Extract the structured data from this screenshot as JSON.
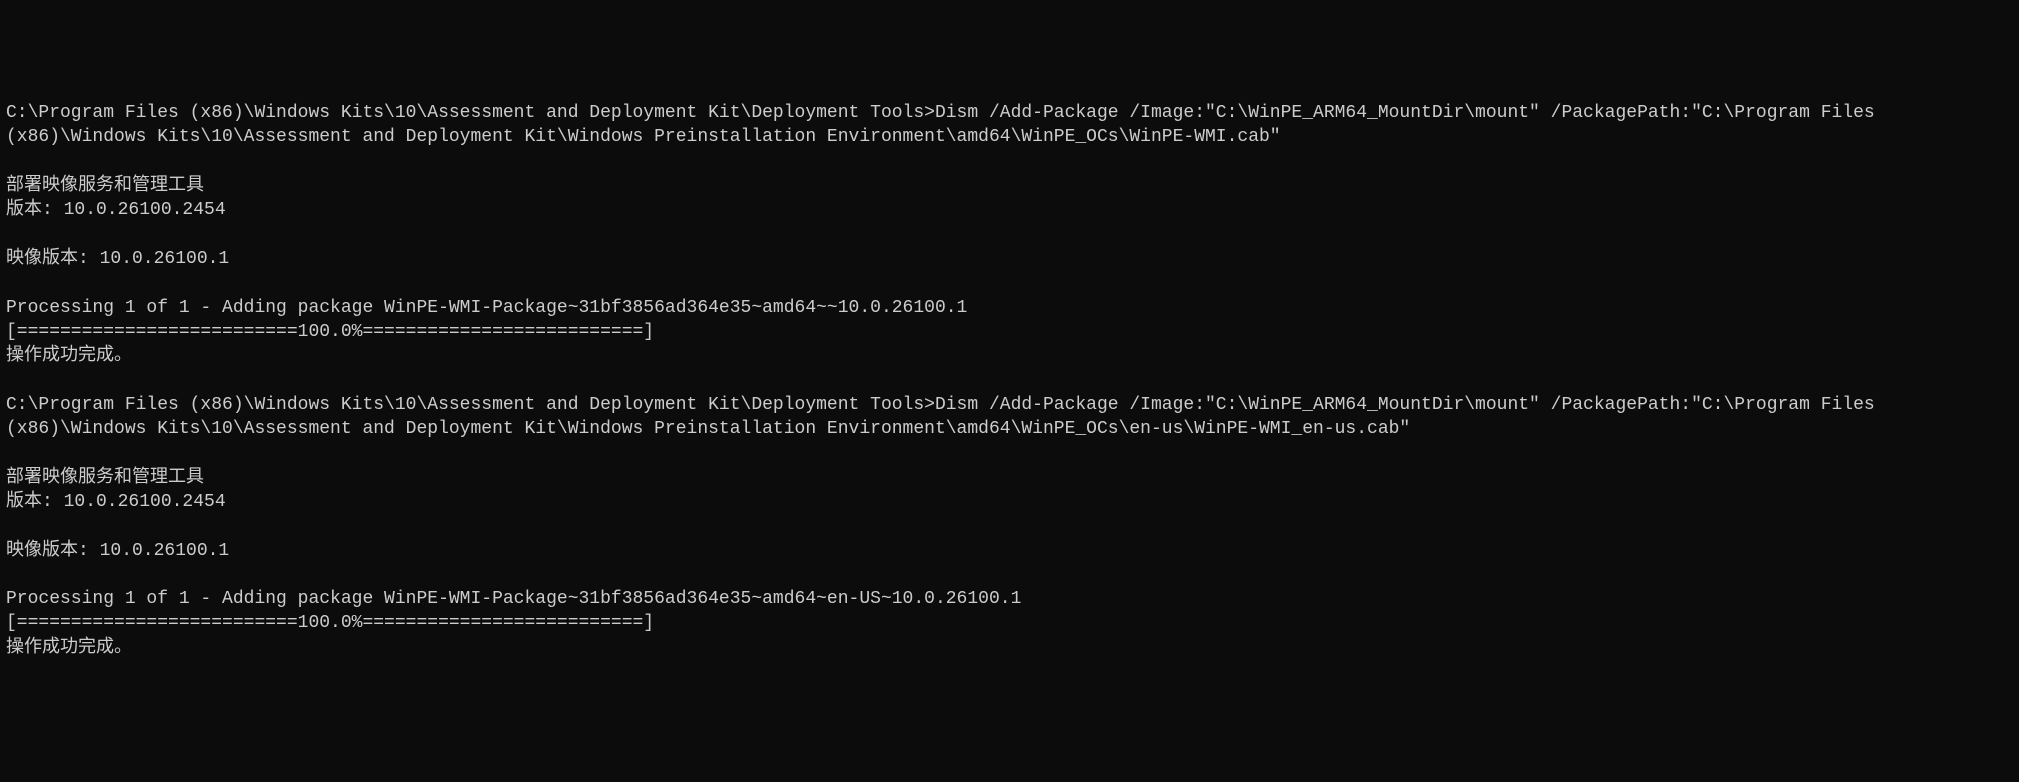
{
  "block1": {
    "prompt": "C:\\Program Files (x86)\\Windows Kits\\10\\Assessment and Deployment Kit\\Deployment Tools>",
    "command": "Dism /Add-Package /Image:\"C:\\WinPE_ARM64_MountDir\\mount\" /PackagePath:\"C:\\Program Files (x86)\\Windows Kits\\10\\Assessment and Deployment Kit\\Windows Preinstallation Environment\\amd64\\WinPE_OCs\\WinPE-WMI.cab\"",
    "tool_name": "部署映像服务和管理工具",
    "version_label": "版本: 10.0.26100.2454",
    "image_version": "映像版本: 10.0.26100.1",
    "processing": "Processing 1 of 1 - Adding package WinPE-WMI-Package~31bf3856ad364e35~amd64~~10.0.26100.1",
    "progress": "[==========================100.0%==========================]",
    "success": "操作成功完成。"
  },
  "block2": {
    "prompt": "C:\\Program Files (x86)\\Windows Kits\\10\\Assessment and Deployment Kit\\Deployment Tools>",
    "command": "Dism /Add-Package /Image:\"C:\\WinPE_ARM64_MountDir\\mount\" /PackagePath:\"C:\\Program Files (x86)\\Windows Kits\\10\\Assessment and Deployment Kit\\Windows Preinstallation Environment\\amd64\\WinPE_OCs\\en-us\\WinPE-WMI_en-us.cab\"",
    "tool_name": "部署映像服务和管理工具",
    "version_label": "版本: 10.0.26100.2454",
    "image_version": "映像版本: 10.0.26100.1",
    "processing": "Processing 1 of 1 - Adding package WinPE-WMI-Package~31bf3856ad364e35~amd64~en-US~10.0.26100.1",
    "progress": "[==========================100.0%==========================]",
    "success": "操作成功完成。"
  }
}
